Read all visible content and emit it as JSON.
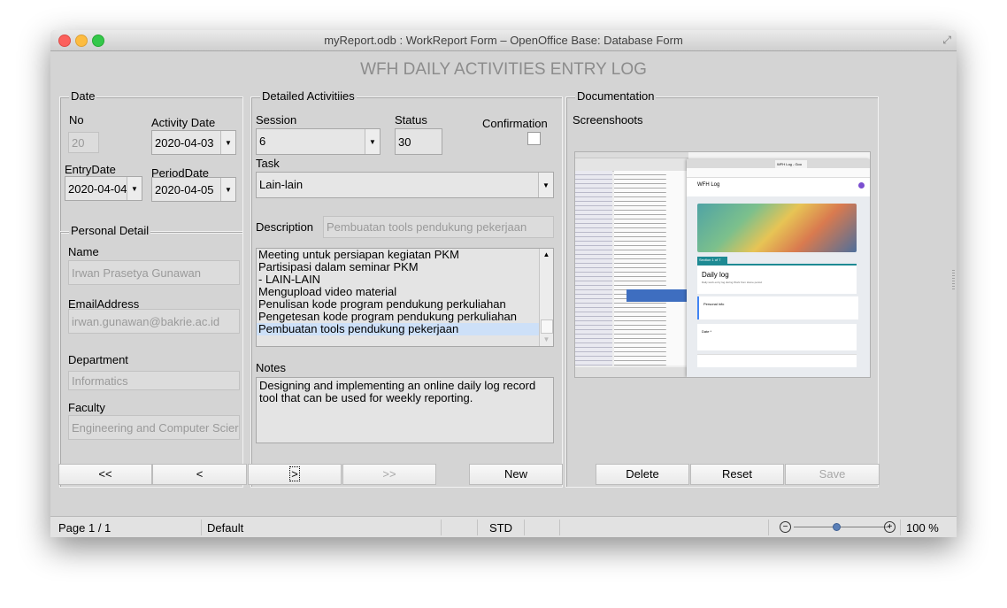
{
  "window": {
    "title": "myReport.odb : WorkReport Form – OpenOffice Base: Database Form"
  },
  "form": {
    "title": "WFH DAILY ACTIVITIES ENTRY LOG"
  },
  "date": {
    "legend": "Date",
    "no_label": "No",
    "no_value": "20",
    "activity_date_label": "Activity Date",
    "activity_date_value": "2020-04-03",
    "entry_date_label": "EntryDate",
    "entry_date_value": "2020-04-04",
    "period_date_label": "PeriodDate",
    "period_date_value": "2020-04-05"
  },
  "personal": {
    "legend": "Personal Detail",
    "name_label": "Name",
    "name_value": "Irwan Prasetya Gunawan",
    "email_label": "EmailAddress",
    "email_value": "irwan.gunawan@bakrie.ac.id",
    "department_label": "Department",
    "department_value": "Informatics",
    "faculty_label": "Faculty",
    "faculty_value": "Engineering and Computer Scier"
  },
  "activities": {
    "legend": "Detailed Activitiies",
    "session_label": "Session",
    "session_value": "6",
    "status_label": "Status",
    "status_value": "30",
    "confirmation_label": "Confirmation",
    "confirmation_checked": false,
    "task_label": "Task",
    "task_value": "Lain-lain",
    "description_label": "Description",
    "description_value": "Pembuatan tools pendukung pekerjaan",
    "description_items": [
      "Meeting untuk persiapan kegiatan PKM",
      "Partisipasi dalam seminar PKM",
      "- LAIN-LAIN",
      "Mengupload video material",
      "Penulisan kode program pendukung perkuliahan",
      "Pengetesan kode program pendukung perkuliahan",
      "Pembuatan tools pendukung pekerjaan"
    ],
    "notes_label": "Notes",
    "notes_value": "Designing and implementing an online daily log record tool that can be used for weekly reporting."
  },
  "documentation": {
    "legend": "Documentation",
    "screenshots_label": "Screenshoots",
    "screenshot": {
      "browser_tab": "WFH Log - Goo",
      "form_title": "WFH Log",
      "section": "Section 1 of 7",
      "card_title": "Daily log",
      "card_desc": "Daily work entry log during Work from Home period",
      "q1": "Personal info",
      "q2": "Date *"
    }
  },
  "nav": {
    "first": "<<",
    "prev": "<",
    "next": ">",
    "last": ">>",
    "new": "New",
    "delete": "Delete",
    "reset": "Reset",
    "save": "Save"
  },
  "statusbar": {
    "page": "Page 1 / 1",
    "style": "Default",
    "mode": "STD",
    "zoom": "100 %"
  },
  "colors": {
    "window_bg": "#d4d4d4",
    "selection": "#cde0f8",
    "title_gray": "#8c8c8c"
  }
}
